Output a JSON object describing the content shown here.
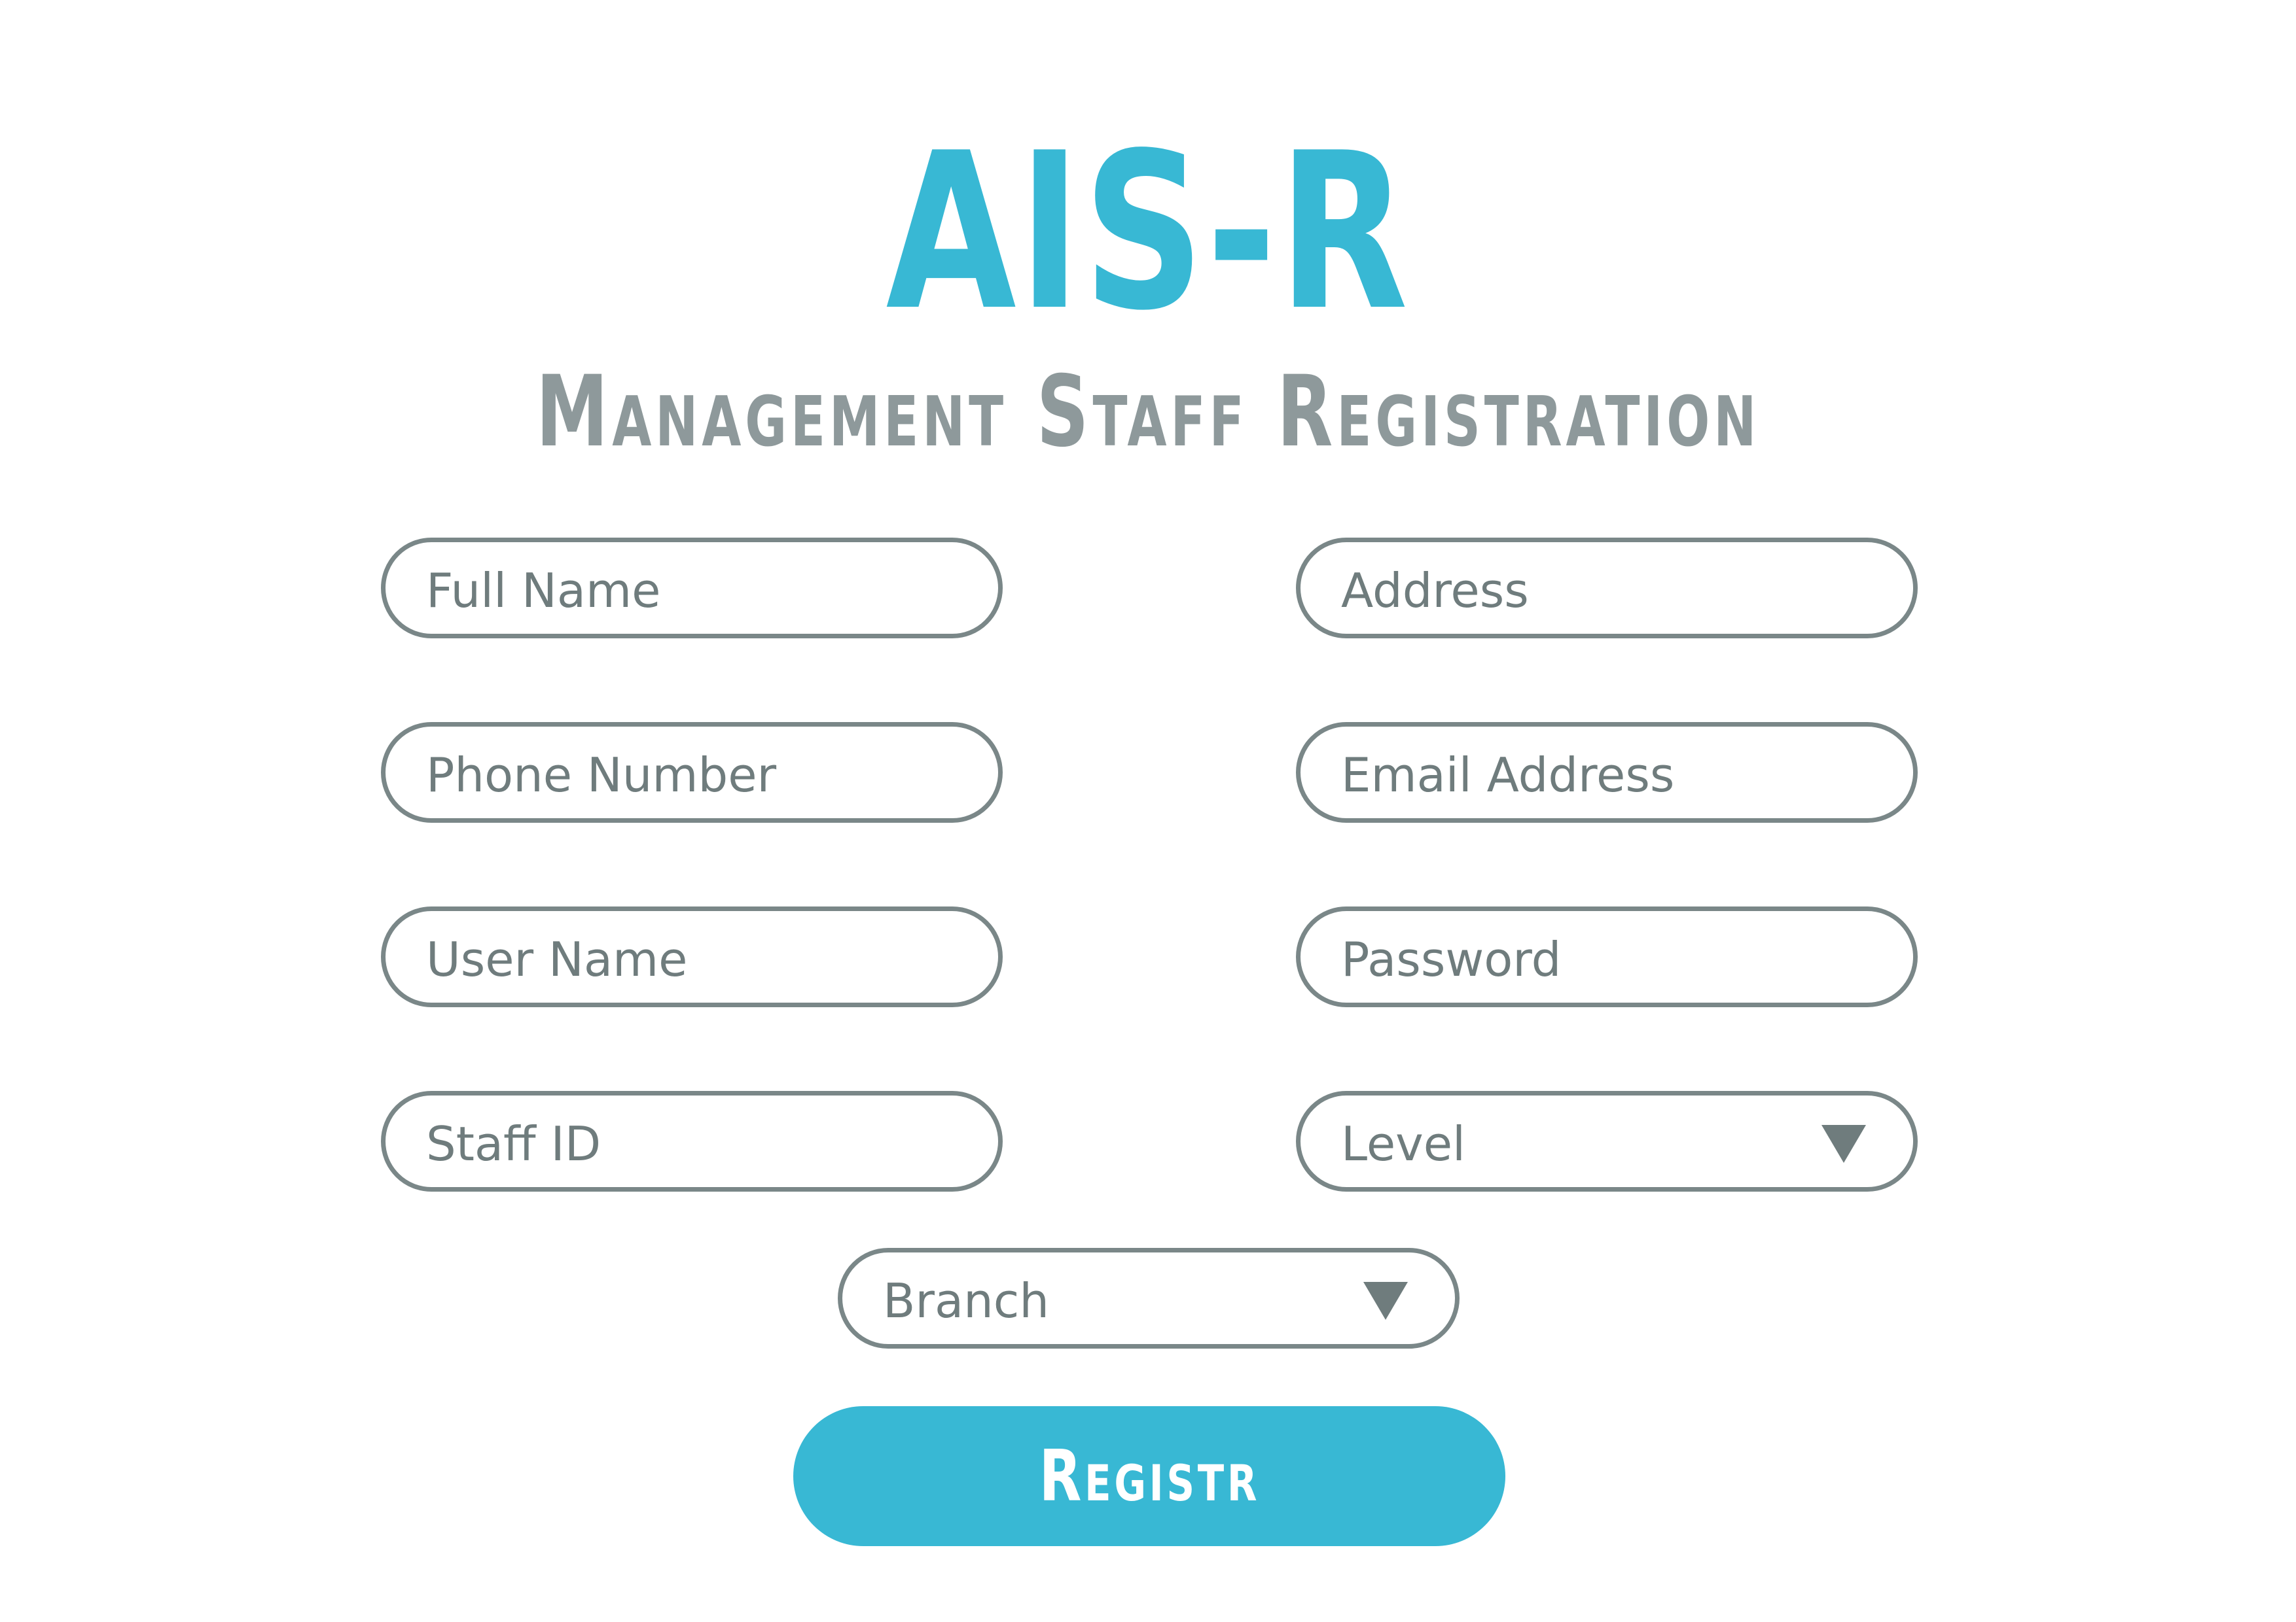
{
  "header": {
    "title": "AIS-R",
    "subtitle": "Management Staff Registration"
  },
  "form": {
    "full_name": {
      "placeholder": "Full Name",
      "value": ""
    },
    "address": {
      "placeholder": "Address",
      "value": ""
    },
    "phone_number": {
      "placeholder": "Phone Number",
      "value": ""
    },
    "email_address": {
      "placeholder": "Email Address",
      "value": ""
    },
    "user_name": {
      "placeholder": "User Name",
      "value": ""
    },
    "password": {
      "placeholder": "Password",
      "value": ""
    },
    "staff_id": {
      "placeholder": "Staff ID",
      "value": ""
    },
    "level": {
      "selected": "Level",
      "icon": "caret-down-icon"
    },
    "branch": {
      "selected": "Branch",
      "icon": "caret-down-icon"
    },
    "submit_label": "Registr"
  },
  "colors": {
    "accent": "#38b8d4",
    "subtitle": "#8e999b",
    "field_border": "#7a8788",
    "field_text": "#6f7c7d",
    "button_text": "#ffffff",
    "background": "#ffffff"
  }
}
